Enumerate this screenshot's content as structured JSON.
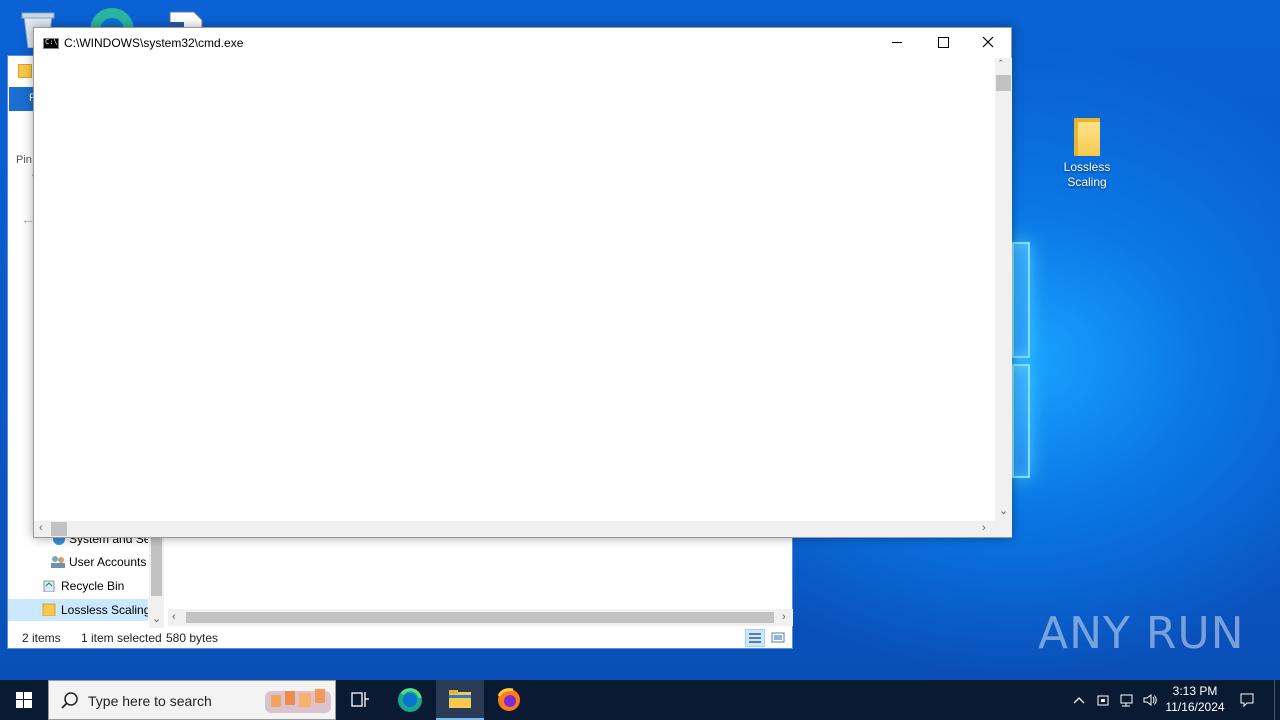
{
  "desktop": {
    "icons": [
      {
        "label": "Lossless Scaling"
      }
    ]
  },
  "cmd_window": {
    "title": "C:\\WINDOWS\\system32\\cmd.exe",
    "minimize_label": "Minimize",
    "maximize_label": "Maximize",
    "close_label": "Close"
  },
  "explorer": {
    "ribbon_tab_label": "F",
    "pinned_text": "Pin",
    "nav_items": [
      {
        "label": "System and Se",
        "icon": "system-icon"
      },
      {
        "label": "User Accounts",
        "icon": "users-icon"
      },
      {
        "label": "Recycle Bin",
        "icon": "recycle-bin-icon"
      },
      {
        "label": "Lossless Scaling",
        "icon": "folder-icon",
        "selected": true
      }
    ],
    "status": {
      "item_count": "2 items",
      "selection": "1 item selected",
      "size": "580 bytes"
    }
  },
  "taskbar": {
    "search_placeholder": "Type here to search",
    "apps": [
      "task-view",
      "edge",
      "file-explorer",
      "firefox"
    ],
    "active_app": "file-explorer",
    "clock_time": "3:13 PM",
    "clock_date": "11/16/2024"
  },
  "watermark": "ANY RUN",
  "colors": {
    "taskbar": "#0b1a33",
    "accent": "#1a6fd1",
    "selection": "#cce8ff"
  }
}
